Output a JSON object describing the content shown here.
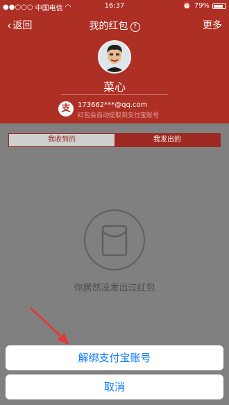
{
  "status_bar": {
    "carrier": "中国电信",
    "time": "16:37",
    "battery": "79%",
    "battery_level": 0.79
  },
  "nav": {
    "back_label": "返回",
    "title": "我的红包",
    "help_icon_text": "?",
    "more_label": "更多"
  },
  "profile": {
    "name": "菜心",
    "account": "173662***@qq.com",
    "note": "红包会自动提取到支付宝账号",
    "alipay_icon_text": "支"
  },
  "tabs": [
    {
      "label": "我收到的",
      "active": false
    },
    {
      "label": "我发出的",
      "active": true
    }
  ],
  "empty_state": {
    "text": "你居然没发出过红包"
  },
  "action_sheet": {
    "unbind_label": "解绑支付宝账号",
    "cancel_label": "取消"
  },
  "colors": {
    "header_red": "#ae2f24",
    "action_blue": "#0a78fe",
    "arrow_red": "#e03a3a"
  }
}
